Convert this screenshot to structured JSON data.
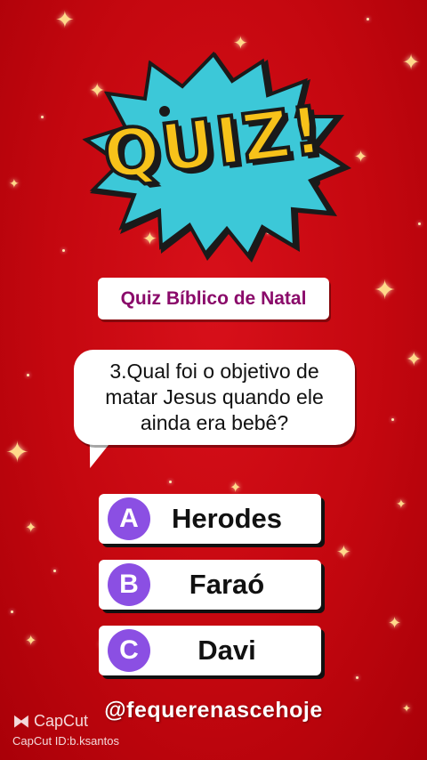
{
  "logo": {
    "text": "QUIZ!"
  },
  "title": "Quiz Bíblico de Natal",
  "question": "3.Qual foi o objetivo de matar Jesus quando ele ainda era bebê?",
  "answers": [
    {
      "letter": "A",
      "text": "Herodes"
    },
    {
      "letter": "B",
      "text": "Faraó"
    },
    {
      "letter": "C",
      "text": "Davi"
    }
  ],
  "handle": "@fequerenascehoje",
  "watermark": {
    "brand": "CapCut",
    "id": "CapCut ID:b.ksantos"
  },
  "colors": {
    "background": "#c4070f",
    "title_text": "#8a0a6a",
    "answer_circle": "#8b4fe3",
    "logo_yellow": "#f7c21a",
    "logo_cyan": "#3cc8d8"
  }
}
